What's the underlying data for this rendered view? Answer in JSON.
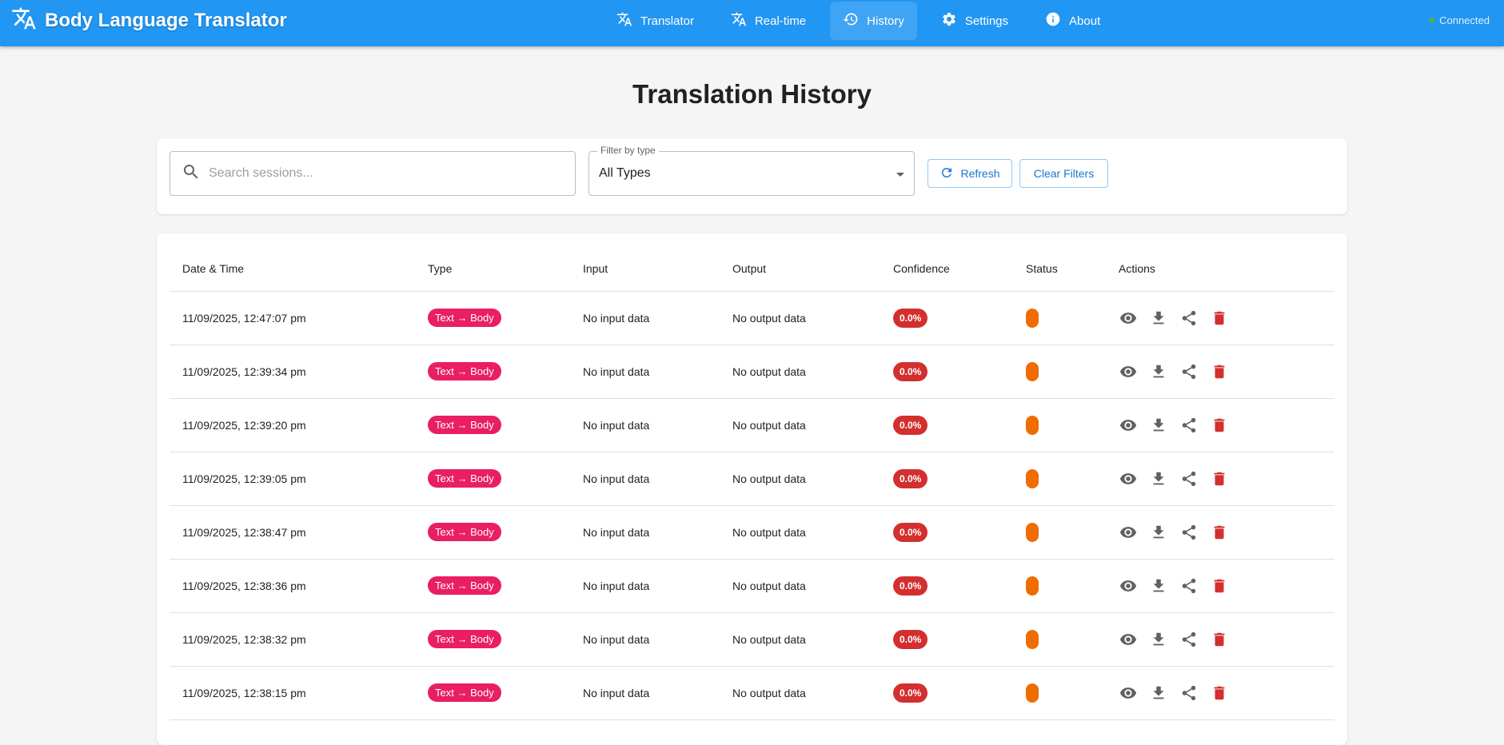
{
  "app": {
    "title": "Body Language Translator",
    "connection_status": "Connected"
  },
  "nav": {
    "items": [
      {
        "label": "Translator",
        "icon": "translate-icon"
      },
      {
        "label": "Real-time",
        "icon": "translate-icon"
      },
      {
        "label": "History",
        "icon": "history-icon",
        "active": true
      },
      {
        "label": "Settings",
        "icon": "gear-icon"
      },
      {
        "label": "About",
        "icon": "info-icon"
      }
    ]
  },
  "page": {
    "title": "Translation History"
  },
  "filters": {
    "search_placeholder": "Search sessions...",
    "search_value": "",
    "type_label": "Filter by type",
    "type_value": "All Types",
    "refresh_label": "Refresh",
    "clear_label": "Clear Filters"
  },
  "table": {
    "headers": [
      "Date & Time",
      "Type",
      "Input",
      "Output",
      "Confidence",
      "Status",
      "Actions"
    ],
    "rows": [
      {
        "datetime": "11/09/2025, 12:47:07 pm",
        "type": "Text → Body",
        "input": "No input data",
        "output": "No output data",
        "confidence": "0.0%"
      },
      {
        "datetime": "11/09/2025, 12:39:34 pm",
        "type": "Text → Body",
        "input": "No input data",
        "output": "No output data",
        "confidence": "0.0%"
      },
      {
        "datetime": "11/09/2025, 12:39:20 pm",
        "type": "Text → Body",
        "input": "No input data",
        "output": "No output data",
        "confidence": "0.0%"
      },
      {
        "datetime": "11/09/2025, 12:39:05 pm",
        "type": "Text → Body",
        "input": "No input data",
        "output": "No output data",
        "confidence": "0.0%"
      },
      {
        "datetime": "11/09/2025, 12:38:47 pm",
        "type": "Text → Body",
        "input": "No input data",
        "output": "No output data",
        "confidence": "0.0%"
      },
      {
        "datetime": "11/09/2025, 12:38:36 pm",
        "type": "Text → Body",
        "input": "No input data",
        "output": "No output data",
        "confidence": "0.0%"
      },
      {
        "datetime": "11/09/2025, 12:38:32 pm",
        "type": "Text → Body",
        "input": "No input data",
        "output": "No output data",
        "confidence": "0.0%"
      },
      {
        "datetime": "11/09/2025, 12:38:15 pm",
        "type": "Text → Body",
        "input": "No input data",
        "output": "No output data",
        "confidence": "0.0%"
      }
    ],
    "row_actions": [
      "eye-icon",
      "download-icon",
      "share-icon",
      "trash-icon"
    ]
  },
  "colors": {
    "appbar": "#2196f3",
    "type_chip": "#e91e63",
    "confidence_chip": "#d32f2f",
    "status_pending": "#ef6c00",
    "delete_action": "#d32f2f",
    "action_icon": "#616161",
    "connected_dot": "#4caf50"
  }
}
